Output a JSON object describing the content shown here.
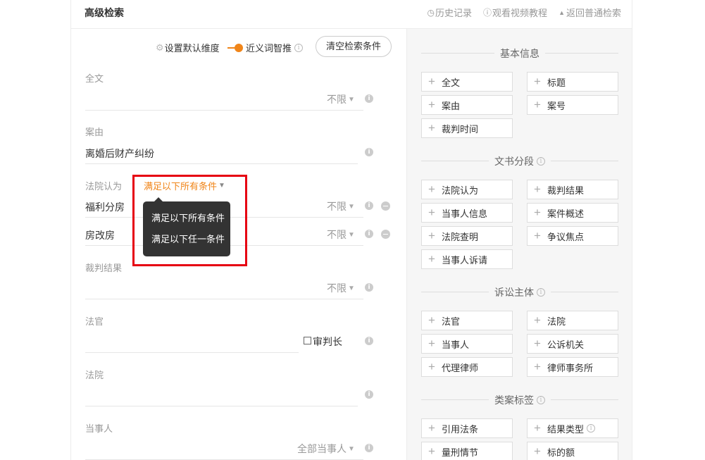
{
  "header": {
    "title": "高级检索",
    "history": "历史记录",
    "video": "观看视频教程",
    "back": "返回普通检索"
  },
  "toolbar": {
    "default_dim": "设置默认维度",
    "synonym": "近义词智推",
    "clear": "清空检索条件"
  },
  "fields": {
    "fulltext": {
      "label": "全文",
      "scope": "不限"
    },
    "cause": {
      "label": "案由",
      "value": "离婚后财产纠纷"
    },
    "court_opinion": {
      "label": "法院认为",
      "condition": "满足以下所有条件",
      "rows": [
        {
          "value": "福利分房",
          "scope": "不限"
        },
        {
          "value": "房改房",
          "scope": "不限"
        }
      ]
    },
    "judgment": {
      "label": "裁判结果",
      "scope": "不限"
    },
    "judge": {
      "label": "法官",
      "checkbox": "审判长"
    },
    "court": {
      "label": "法院"
    },
    "party": {
      "label": "当事人",
      "scope": "全部当事人"
    }
  },
  "dropdown": {
    "options": [
      "满足以下所有条件",
      "满足以下任一条件"
    ]
  },
  "sidebar": {
    "sections": [
      {
        "title": "基本信息",
        "items": [
          "全文",
          "标题",
          "案由",
          "案号",
          "裁判时间"
        ]
      },
      {
        "title": "文书分段",
        "items": [
          "法院认为",
          "裁判结果",
          "当事人信息",
          "案件概述",
          "法院查明",
          "争议焦点",
          "当事人诉请"
        ]
      },
      {
        "title": "诉讼主体",
        "items": [
          "法官",
          "法院",
          "当事人",
          "公诉机关",
          "代理律师",
          "律师事务所"
        ]
      },
      {
        "title": "类案标签",
        "items": [
          "引用法条",
          "结果类型",
          "量刑情节",
          "标的额"
        ]
      }
    ]
  },
  "colors": {
    "accent": "#f08519",
    "highlight_box": "#e60012",
    "tooltip_bg": "#333333"
  },
  "icons": [
    "clock-icon",
    "info-icon",
    "triangle-up-icon",
    "gear-icon",
    "toggle-icon",
    "chevron-down-icon",
    "minus-circle-icon",
    "plus-icon"
  ]
}
